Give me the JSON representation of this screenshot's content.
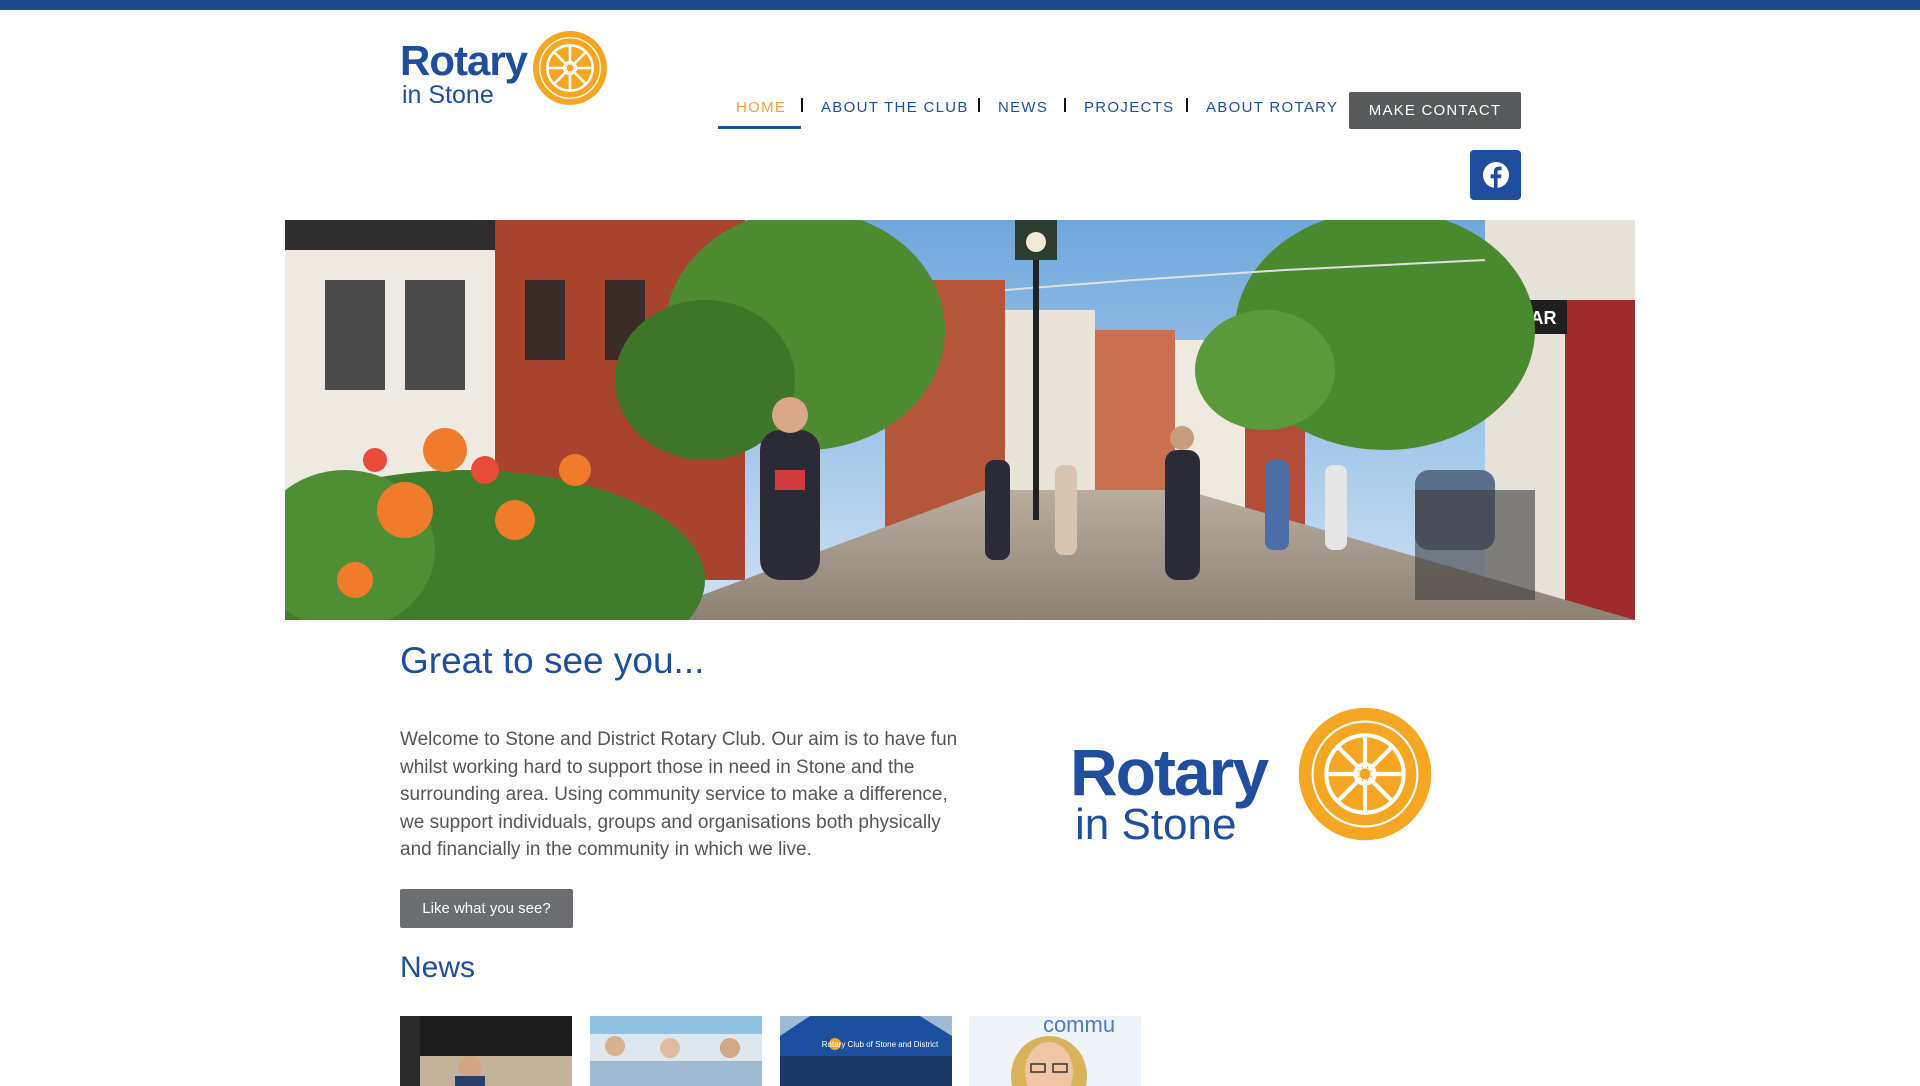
{
  "brand": {
    "logo_main": "Rotary",
    "logo_sub": "in Stone",
    "primary_color": "#1f4e9e",
    "accent_color": "#f5a623",
    "button_color": "#58595b"
  },
  "nav": {
    "items": [
      {
        "label": "HOME",
        "active": true
      },
      {
        "label": "ABOUT THE CLUB",
        "active": false
      },
      {
        "label": "NEWS",
        "active": false
      },
      {
        "label": "PROJECTS",
        "active": false
      },
      {
        "label": "ABOUT ROTARY",
        "active": false
      }
    ],
    "contact_label": "MAKE CONTACT",
    "social_icon": "facebook-icon"
  },
  "hero": {
    "icon": "town-street-photo"
  },
  "welcome": {
    "title": "Great to see you...",
    "text": "Welcome to Stone and District Rotary Club. Our aim is to have fun whilst working hard to support those in need in Stone and the surrounding area. Using community service to make a difference, we support individuals, groups and organisations both physically and financially in the community in which we live.",
    "button_label": "Like what you see?"
  },
  "news": {
    "title": "News",
    "cards": [
      {
        "icon": "news-photo-presentation"
      },
      {
        "icon": "news-photo-stall"
      },
      {
        "icon": "news-photo-gazebo",
        "caption": "Rotary Club of Stone and District"
      },
      {
        "icon": "news-photo-portrait",
        "caption": "commu"
      }
    ]
  }
}
